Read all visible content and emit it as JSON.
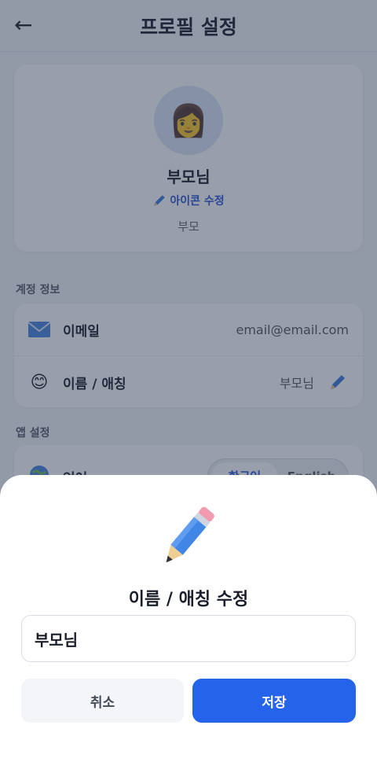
{
  "header": {
    "title": "프로필 설정",
    "back_icon": "arrow-left-icon"
  },
  "profile": {
    "avatar_emoji": "👩",
    "name": "부모님",
    "edit_icon_label": "아이콘 수정",
    "role": "부모"
  },
  "account": {
    "section_label": "계정 정보",
    "email_label": "이메일",
    "email_value": "email@email.com",
    "name_label": "이름 / 애칭",
    "name_value": "부모님",
    "name_icon_emoji": "😊"
  },
  "app_settings": {
    "section_label": "앱 설정",
    "language_label": "언어",
    "language_options": [
      "한국어",
      "English"
    ],
    "language_selected": "한국어"
  },
  "sheet": {
    "title": "이름 / 애칭 수정",
    "input_value": "부모님",
    "cancel_label": "취소",
    "save_label": "저장"
  },
  "colors": {
    "accent": "#2563eb",
    "overlay": "#28344e"
  }
}
